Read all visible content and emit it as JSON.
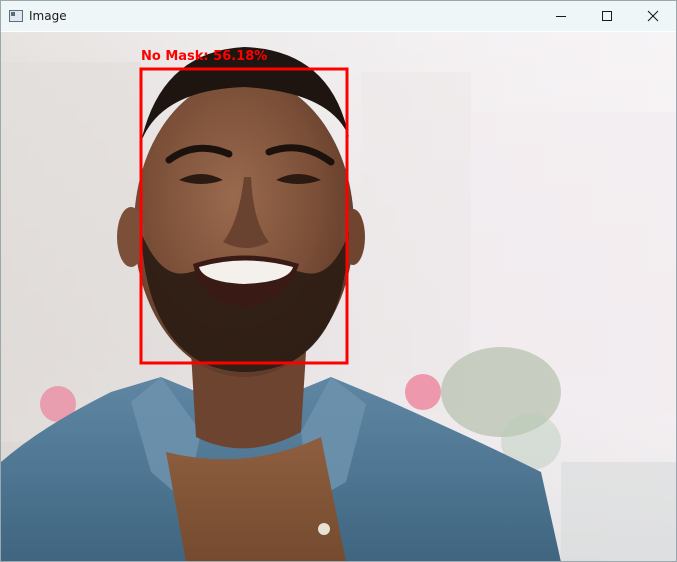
{
  "window": {
    "title": "Image",
    "app_icon": "image-window-icon",
    "controls": {
      "minimize_icon": "minimize-icon",
      "maximize_icon": "maximize-icon",
      "close_icon": "close-icon"
    }
  },
  "detection": {
    "label": "No Mask: 56.18%",
    "box_color": "#ff0000"
  },
  "colors": {
    "titlebar_bg": "#eef6f8",
    "detection_red": "#ff0000"
  }
}
